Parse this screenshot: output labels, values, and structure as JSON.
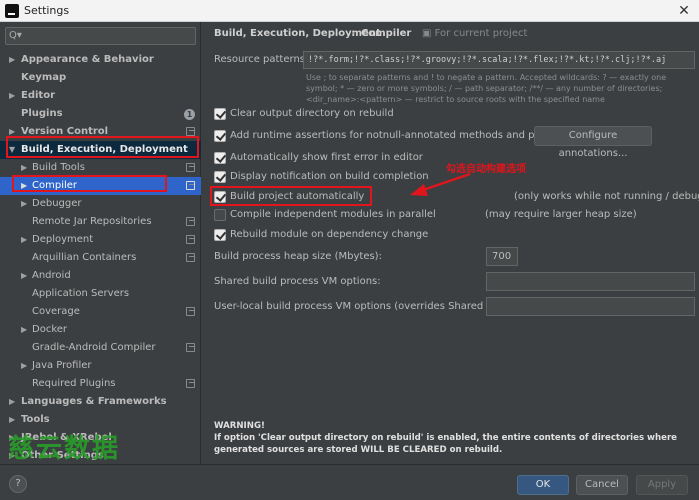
{
  "window": {
    "title": "Settings"
  },
  "search": {
    "placeholder": ""
  },
  "sidebar": {
    "items": [
      {
        "label": "Appearance & Behavior"
      },
      {
        "label": "Keymap"
      },
      {
        "label": "Editor"
      },
      {
        "label": "Plugins",
        "badge": "1"
      },
      {
        "label": "Version Control"
      },
      {
        "label": "Build, Execution, Deployment"
      },
      {
        "label": "Build Tools"
      },
      {
        "label": "Compiler"
      },
      {
        "label": "Debugger"
      },
      {
        "label": "Remote Jar Repositories"
      },
      {
        "label": "Deployment"
      },
      {
        "label": "Arquillian Containers"
      },
      {
        "label": "Android"
      },
      {
        "label": "Application Servers"
      },
      {
        "label": "Coverage"
      },
      {
        "label": "Docker"
      },
      {
        "label": "Gradle-Android Compiler"
      },
      {
        "label": "Java Profiler"
      },
      {
        "label": "Required Plugins"
      },
      {
        "label": "Languages & Frameworks"
      },
      {
        "label": "Tools"
      },
      {
        "label": "JRebel & XRebel"
      },
      {
        "label": "Other Settings"
      }
    ]
  },
  "watermark": "慈云数据",
  "breadcrumb": {
    "parent": "Build, Execution, Deployment",
    "separator": "›",
    "page": "Compiler",
    "scope": "For current project"
  },
  "resource": {
    "label": "Resource patterns:",
    "value": "!?*.form;!?*.class;!?*.groovy;!?*.scala;!?*.flex;!?*.kt;!?*.clj;!?*.aj",
    "help": "Use ; to separate patterns and ! to negate a pattern. Accepted wildcards: ? — exactly one symbol; * — zero or more symbols; / — path separator; /**/ — any number of directories; <dir_name>:<pattern> — restrict to source roots with the specified name"
  },
  "options": [
    {
      "label": "Clear output directory on rebuild",
      "checked": true
    },
    {
      "label": "Add runtime assertions for notnull-annotated methods and parameters",
      "checked": true,
      "button": "Configure annotations..."
    },
    {
      "label": "Automatically show first error in editor",
      "checked": true
    },
    {
      "label": "Display notification on build completion",
      "checked": true
    },
    {
      "label": "Build project automatically",
      "checked": true,
      "note": "(only works while not running / debugging)"
    },
    {
      "label": "Compile independent modules in parallel",
      "checked": false,
      "note": "(may require larger heap size)"
    },
    {
      "label": "Rebuild module on dependency change",
      "checked": true
    }
  ],
  "heap": {
    "label": "Build process heap size (Mbytes):",
    "value": "700"
  },
  "shared_vm": {
    "label": "Shared build process VM options:",
    "value": ""
  },
  "user_vm": {
    "label": "User-local build process VM options (overrides Shared options):",
    "value": ""
  },
  "annotation": {
    "text": "勾选自动构建选项",
    "color": "#e2141c"
  },
  "warning": {
    "title": "WARNING!",
    "body": "If option 'Clear output directory on rebuild' is enabled, the entire contents of directories where generated sources are stored WILL BE CLEARED on rebuild."
  },
  "footer": {
    "help": "?",
    "ok": "OK",
    "cancel": "Cancel",
    "apply": "Apply"
  },
  "colors": {
    "background": "#3c3f41",
    "selection": "#2f65ca",
    "highlight": "#e2141c",
    "primary_button": "#365880"
  }
}
